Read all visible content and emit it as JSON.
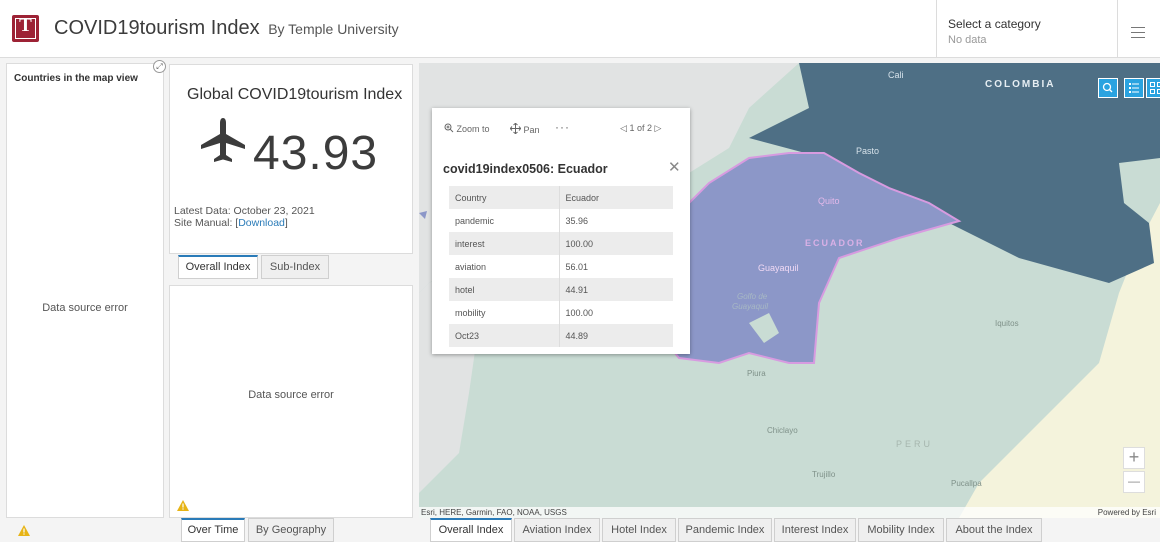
{
  "header": {
    "logo_letter": "T",
    "title": "COVID19tourism Index",
    "subtitle": "By Temple University",
    "category_label": "Select a category",
    "category_value": "No data"
  },
  "left_panel": {
    "title": "Countries in the map view",
    "error": "Data source error"
  },
  "index_card": {
    "title": "Global COVID19tourism Index",
    "value": "43.93",
    "latest_data": "Latest Data: October 23, 2021",
    "manual_prefix": "Site Manual: [",
    "manual_link": "Download",
    "manual_suffix": "]"
  },
  "index_tabs": [
    "Overall Index",
    "Sub-Index"
  ],
  "chart_card": {
    "error": "Data source error"
  },
  "chart_tabs": [
    "Over Time",
    "By Geography"
  ],
  "popup": {
    "zoom_label": "Zoom to",
    "pan_label": "Pan",
    "more_label": "···",
    "pager": "1 of 2",
    "title": "covid19index0506: Ecuador",
    "rows": [
      {
        "key": "Country",
        "value": "Ecuador"
      },
      {
        "key": "pandemic",
        "value": "35.96"
      },
      {
        "key": "interest",
        "value": "100.00"
      },
      {
        "key": "aviation",
        "value": "56.01"
      },
      {
        "key": "hotel",
        "value": "44.91"
      },
      {
        "key": "mobility",
        "value": "100.00"
      },
      {
        "key": "Oct23",
        "value": "44.89"
      }
    ]
  },
  "map": {
    "labels": {
      "cali": "Cali",
      "colombia": "COLOMBIA",
      "pasto": "Pasto",
      "quito": "Quito",
      "ecuador": "ECUADOR",
      "guayaquil": "Guayaquil",
      "golfo1": "Golfo de",
      "golfo2": "Guayaquil",
      "iquitos": "Iquitos",
      "piura": "Piura",
      "chiclayo": "Chiclayo",
      "peru": "PERU",
      "trujillo": "Trujillo",
      "pucallpa": "Pucallpa"
    },
    "attribution": "Esri, HERE, Garmin, FAO, NOAA, USGS",
    "powered_by": "Powered by Esri",
    "zoom_in": "+",
    "zoom_out": "—"
  },
  "bottom_tabs": [
    "Overall Index",
    "Aviation Index",
    "Hotel Index",
    "Pandemic Index",
    "Interest Index",
    "Mobility Index",
    "About the Index"
  ],
  "colors": {
    "brand": "#9d2235",
    "accent": "#2a7bb8",
    "colombia": "#4e6f85",
    "ecuador": "#8c97c8",
    "peru": "#c9dcd4",
    "brazil": "#f4f3dc"
  }
}
